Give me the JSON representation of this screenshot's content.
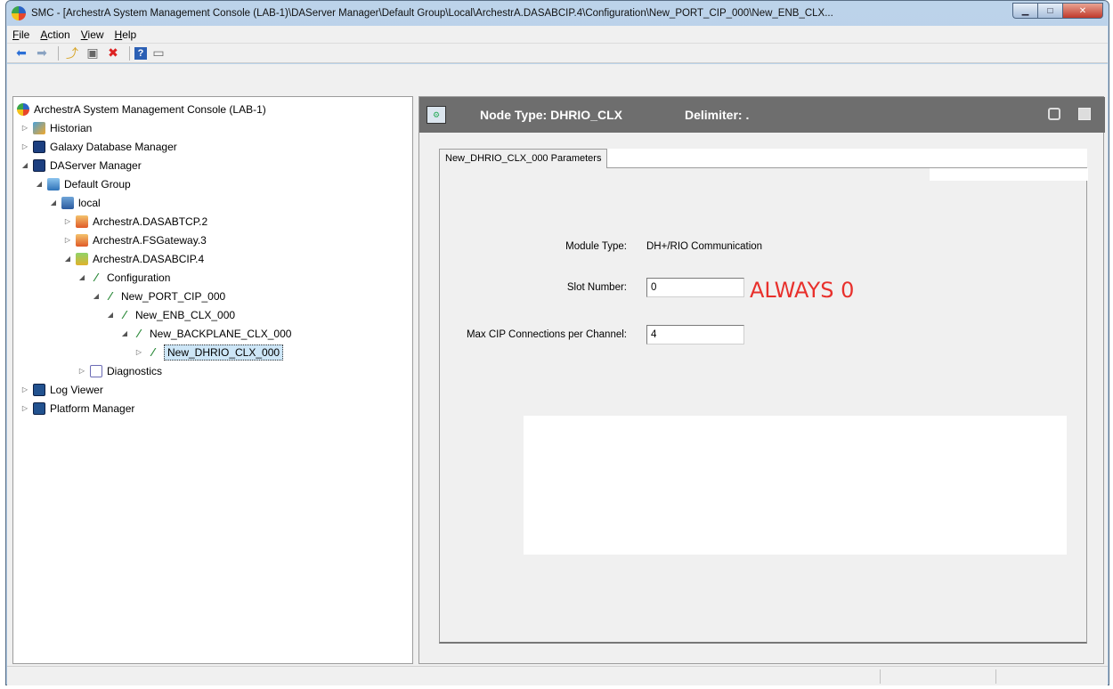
{
  "window": {
    "title": "SMC - [ArchestrA System Management Console (LAB-1)\\DAServer Manager\\Default Group\\Local\\ArchestrA.DASABCIP.4\\Configuration\\New_PORT_CIP_000\\New_ENB_CLX..."
  },
  "menu": [
    "File",
    "Action",
    "View",
    "Help"
  ],
  "toolbar": [
    "back-arrow-icon",
    "forward-arrow-icon",
    "up-folder-icon",
    "show-hide-tree-icon",
    "delete-icon",
    "help-icon",
    "view-icon"
  ],
  "tree": [
    {
      "label": "ArchestrA System Management Console (LAB-1)",
      "icon": "console-orb-icon",
      "level": 0,
      "expander": ""
    },
    {
      "label": "Historian",
      "icon": "historian-icon",
      "level": 1,
      "expander": "▷"
    },
    {
      "label": "Galaxy Database Manager",
      "icon": "database-manager-icon",
      "level": 1,
      "expander": "▷"
    },
    {
      "label": "DAServer Manager",
      "icon": "daserver-manager-icon",
      "level": 1,
      "expander": "◢"
    },
    {
      "label": "Default Group",
      "icon": "group-icon",
      "level": 2,
      "expander": "◢"
    },
    {
      "label": "local",
      "icon": "local-node-icon",
      "level": 3,
      "expander": "◢"
    },
    {
      "label": "ArchestrA.DASABTCP.2",
      "icon": "daserver-stopped-icon",
      "level": 4,
      "expander": "▷"
    },
    {
      "label": "ArchestrA.FSGateway.3",
      "icon": "daserver-stopped-icon",
      "level": 4,
      "expander": "▷"
    },
    {
      "label": "ArchestrA.DASABCIP.4",
      "icon": "daserver-running-icon",
      "level": 4,
      "expander": "◢"
    },
    {
      "label": "Configuration",
      "icon": "configuration-icon",
      "level": 5,
      "expander": "◢"
    },
    {
      "label": "New_PORT_CIP_000",
      "icon": "configuration-icon",
      "level": 6,
      "expander": "◢"
    },
    {
      "label": "New_ENB_CLX_000",
      "icon": "configuration-icon",
      "level": 7,
      "expander": "◢"
    },
    {
      "label": "New_BACKPLANE_CLX_000",
      "icon": "configuration-icon",
      "level": 8,
      "expander": "◢"
    },
    {
      "label": "New_DHRIO_CLX_000",
      "icon": "configuration-icon",
      "level": 9,
      "expander": "▷",
      "selected": true
    },
    {
      "label": "Diagnostics",
      "icon": "diagnostics-icon",
      "level": 5,
      "expander": "▷"
    },
    {
      "label": "Log Viewer",
      "icon": "log-viewer-icon",
      "level": 1,
      "expander": "▷"
    },
    {
      "label": "Platform Manager",
      "icon": "platform-manager-icon",
      "level": 1,
      "expander": "▷"
    }
  ],
  "details": {
    "node_type": "Node Type: DHRIO_CLX",
    "delimiter": "Delimiter: .",
    "tab_label": "New_DHRIO_CLX_000 Parameters",
    "module_type_label": "Module Type:",
    "module_type_value": "DH+/RIO Communication",
    "slot_number_label": "Slot Number:",
    "slot_number_value": "0",
    "max_cip_label": "Max CIP Connections per Channel:",
    "max_cip_value": "4",
    "annotation": "ALWAYS 0"
  },
  "colors": {
    "annotation": "#e8302c",
    "header_bar": "#6e6e6e",
    "selection": "#cde6f7"
  }
}
